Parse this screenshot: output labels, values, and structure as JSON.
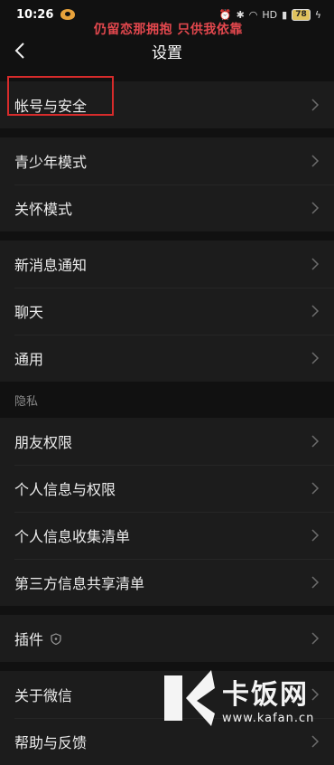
{
  "status_bar": {
    "time": "10:26",
    "overlay_text": "仍留恋那拥抱 只供我依靠",
    "network_label": "HD",
    "battery": "78"
  },
  "header": {
    "title": "设置"
  },
  "groups": [
    {
      "items": [
        {
          "label": "帐号与安全"
        }
      ]
    },
    {
      "items": [
        {
          "label": "青少年模式"
        },
        {
          "label": "关怀模式"
        }
      ]
    },
    {
      "items": [
        {
          "label": "新消息通知"
        },
        {
          "label": "聊天"
        },
        {
          "label": "通用"
        }
      ]
    },
    {
      "section_title": "隐私",
      "items": [
        {
          "label": "朋友权限"
        },
        {
          "label": "个人信息与权限"
        },
        {
          "label": "个人信息收集清单"
        },
        {
          "label": "第三方信息共享清单"
        }
      ]
    },
    {
      "items": [
        {
          "label": "插件",
          "icon": "shield-icon"
        }
      ]
    },
    {
      "items": [
        {
          "label": "关于微信"
        },
        {
          "label": "帮助与反馈"
        }
      ]
    }
  ],
  "watermark": {
    "brand": "卡饭网",
    "url": "www.kafan.cn"
  },
  "colors": {
    "highlight": "#d72b2b",
    "overlay": "#e4484e",
    "background": "#111111",
    "row": "#1c1c1c"
  }
}
